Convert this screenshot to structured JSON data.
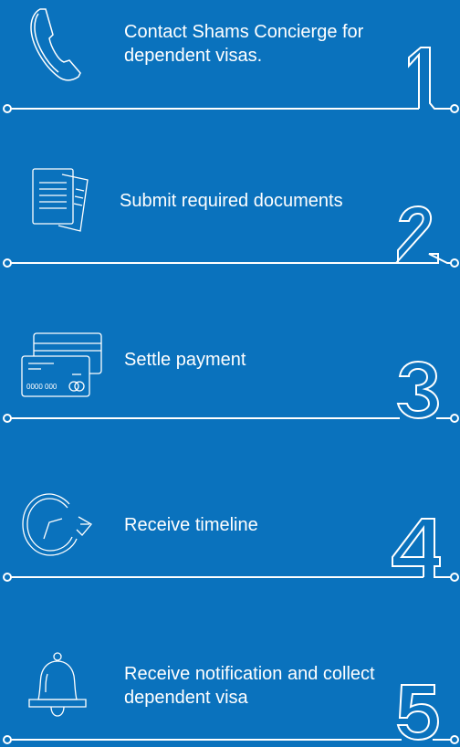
{
  "theme": {
    "background": "#0a72bd",
    "foreground": "#ffffff"
  },
  "steps": [
    {
      "number": "1",
      "text": "Contact Shams Concierge for\ndependent visas.",
      "icon": "phone-icon"
    },
    {
      "number": "2",
      "text": "Submit required documents",
      "icon": "documents-icon"
    },
    {
      "number": "3",
      "text": "Settle payment",
      "icon": "credit-card-icon"
    },
    {
      "number": "4",
      "text": "Receive timeline",
      "icon": "clock-timeline-icon"
    },
    {
      "number": "5",
      "text": "Receive notification and collect\ndependent visa",
      "icon": "bell-icon"
    }
  ],
  "card": {
    "number_text": "0000 000"
  }
}
